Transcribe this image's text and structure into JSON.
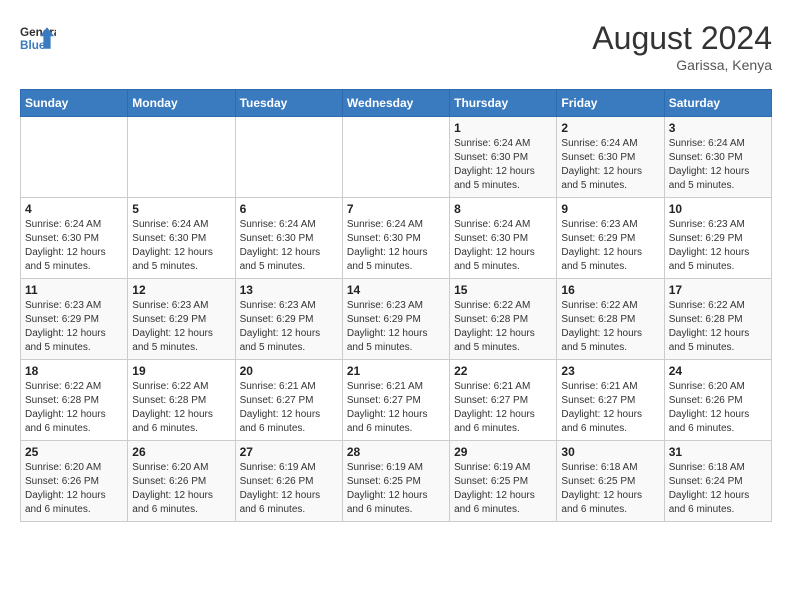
{
  "header": {
    "logo_line1": "General",
    "logo_line2": "Blue",
    "month_year": "August 2024",
    "location": "Garissa, Kenya"
  },
  "weekdays": [
    "Sunday",
    "Monday",
    "Tuesday",
    "Wednesday",
    "Thursday",
    "Friday",
    "Saturday"
  ],
  "weeks": [
    [
      {
        "day": "",
        "info": ""
      },
      {
        "day": "",
        "info": ""
      },
      {
        "day": "",
        "info": ""
      },
      {
        "day": "",
        "info": ""
      },
      {
        "day": "1",
        "info": "Sunrise: 6:24 AM\nSunset: 6:30 PM\nDaylight: 12 hours and 5 minutes."
      },
      {
        "day": "2",
        "info": "Sunrise: 6:24 AM\nSunset: 6:30 PM\nDaylight: 12 hours and 5 minutes."
      },
      {
        "day": "3",
        "info": "Sunrise: 6:24 AM\nSunset: 6:30 PM\nDaylight: 12 hours and 5 minutes."
      }
    ],
    [
      {
        "day": "4",
        "info": "Sunrise: 6:24 AM\nSunset: 6:30 PM\nDaylight: 12 hours and 5 minutes."
      },
      {
        "day": "5",
        "info": "Sunrise: 6:24 AM\nSunset: 6:30 PM\nDaylight: 12 hours and 5 minutes."
      },
      {
        "day": "6",
        "info": "Sunrise: 6:24 AM\nSunset: 6:30 PM\nDaylight: 12 hours and 5 minutes."
      },
      {
        "day": "7",
        "info": "Sunrise: 6:24 AM\nSunset: 6:30 PM\nDaylight: 12 hours and 5 minutes."
      },
      {
        "day": "8",
        "info": "Sunrise: 6:24 AM\nSunset: 6:30 PM\nDaylight: 12 hours and 5 minutes."
      },
      {
        "day": "9",
        "info": "Sunrise: 6:23 AM\nSunset: 6:29 PM\nDaylight: 12 hours and 5 minutes."
      },
      {
        "day": "10",
        "info": "Sunrise: 6:23 AM\nSunset: 6:29 PM\nDaylight: 12 hours and 5 minutes."
      }
    ],
    [
      {
        "day": "11",
        "info": "Sunrise: 6:23 AM\nSunset: 6:29 PM\nDaylight: 12 hours and 5 minutes."
      },
      {
        "day": "12",
        "info": "Sunrise: 6:23 AM\nSunset: 6:29 PM\nDaylight: 12 hours and 5 minutes."
      },
      {
        "day": "13",
        "info": "Sunrise: 6:23 AM\nSunset: 6:29 PM\nDaylight: 12 hours and 5 minutes."
      },
      {
        "day": "14",
        "info": "Sunrise: 6:23 AM\nSunset: 6:29 PM\nDaylight: 12 hours and 5 minutes."
      },
      {
        "day": "15",
        "info": "Sunrise: 6:22 AM\nSunset: 6:28 PM\nDaylight: 12 hours and 5 minutes."
      },
      {
        "day": "16",
        "info": "Sunrise: 6:22 AM\nSunset: 6:28 PM\nDaylight: 12 hours and 5 minutes."
      },
      {
        "day": "17",
        "info": "Sunrise: 6:22 AM\nSunset: 6:28 PM\nDaylight: 12 hours and 5 minutes."
      }
    ],
    [
      {
        "day": "18",
        "info": "Sunrise: 6:22 AM\nSunset: 6:28 PM\nDaylight: 12 hours and 6 minutes."
      },
      {
        "day": "19",
        "info": "Sunrise: 6:22 AM\nSunset: 6:28 PM\nDaylight: 12 hours and 6 minutes."
      },
      {
        "day": "20",
        "info": "Sunrise: 6:21 AM\nSunset: 6:27 PM\nDaylight: 12 hours and 6 minutes."
      },
      {
        "day": "21",
        "info": "Sunrise: 6:21 AM\nSunset: 6:27 PM\nDaylight: 12 hours and 6 minutes."
      },
      {
        "day": "22",
        "info": "Sunrise: 6:21 AM\nSunset: 6:27 PM\nDaylight: 12 hours and 6 minutes."
      },
      {
        "day": "23",
        "info": "Sunrise: 6:21 AM\nSunset: 6:27 PM\nDaylight: 12 hours and 6 minutes."
      },
      {
        "day": "24",
        "info": "Sunrise: 6:20 AM\nSunset: 6:26 PM\nDaylight: 12 hours and 6 minutes."
      }
    ],
    [
      {
        "day": "25",
        "info": "Sunrise: 6:20 AM\nSunset: 6:26 PM\nDaylight: 12 hours and 6 minutes."
      },
      {
        "day": "26",
        "info": "Sunrise: 6:20 AM\nSunset: 6:26 PM\nDaylight: 12 hours and 6 minutes."
      },
      {
        "day": "27",
        "info": "Sunrise: 6:19 AM\nSunset: 6:26 PM\nDaylight: 12 hours and 6 minutes."
      },
      {
        "day": "28",
        "info": "Sunrise: 6:19 AM\nSunset: 6:25 PM\nDaylight: 12 hours and 6 minutes."
      },
      {
        "day": "29",
        "info": "Sunrise: 6:19 AM\nSunset: 6:25 PM\nDaylight: 12 hours and 6 minutes."
      },
      {
        "day": "30",
        "info": "Sunrise: 6:18 AM\nSunset: 6:25 PM\nDaylight: 12 hours and 6 minutes."
      },
      {
        "day": "31",
        "info": "Sunrise: 6:18 AM\nSunset: 6:24 PM\nDaylight: 12 hours and 6 minutes."
      }
    ]
  ]
}
